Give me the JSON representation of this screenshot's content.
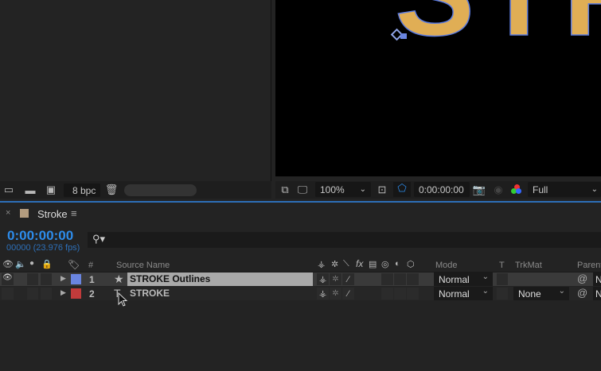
{
  "project_panel": {
    "bpc": "8 bpc",
    "icons": [
      "interpret-footage-icon",
      "new-folder-icon",
      "new-composition-icon",
      "delete-icon"
    ]
  },
  "viewer": {
    "comp_text": "STR",
    "text_fill": "#E0AE55",
    "text_stroke": "#5B7BE0",
    "zoom": "100%",
    "timecode": "0:00:00:00",
    "resolution": "Full"
  },
  "timeline": {
    "comp_name": "Stroke",
    "comp_color": "#B39C7F",
    "current_time": "0:00:00:00",
    "frame_info": "00000 (23.976 fps)",
    "search_icon": "search-icon",
    "columns": {
      "number": "#",
      "source_name": "Source Name",
      "mode": "Mode",
      "t": "T",
      "trkmat": "TrkMat",
      "parent": "Parent"
    },
    "layers": [
      {
        "index": "1",
        "name": "STROKE Outlines",
        "type": "shape",
        "label_color": "#6A85E0",
        "mode": "Normal",
        "trkmat": "",
        "visible": true,
        "selected": true,
        "parent": "N"
      },
      {
        "index": "2",
        "name": "STROKE",
        "type": "text",
        "label_color": "#C23B3B",
        "mode": "Normal",
        "trkmat": "None",
        "visible": false,
        "selected": false,
        "parent": "N"
      }
    ]
  },
  "accent": "#2D8CEB"
}
